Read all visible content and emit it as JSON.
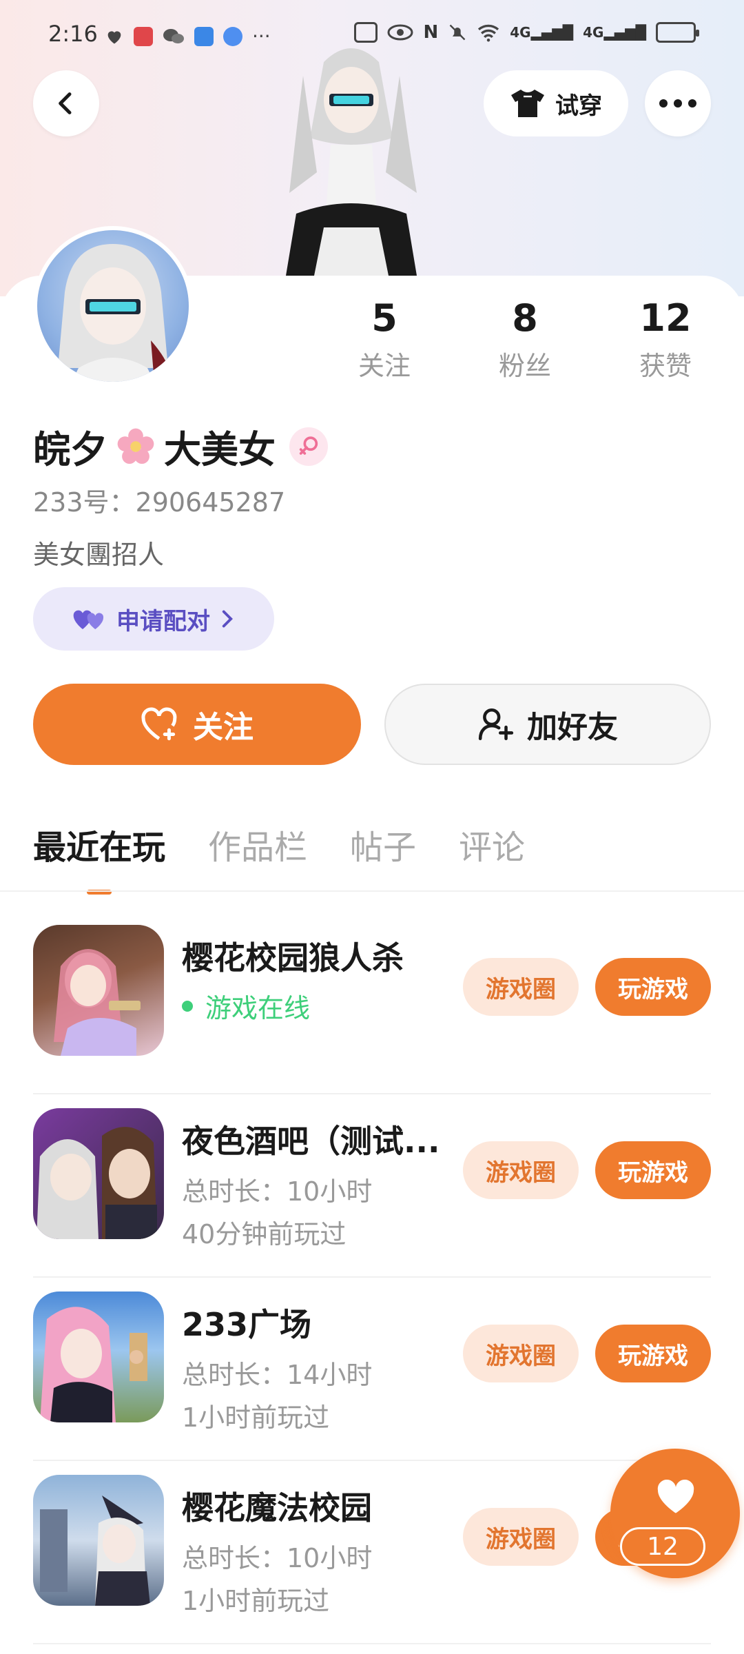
{
  "status_bar": {
    "time": "2:16",
    "more": "···",
    "net1": "4G",
    "net2": "4G"
  },
  "header": {
    "tryon_label": "试穿"
  },
  "profile": {
    "followers_label_follow": "关注",
    "follow_count": "5",
    "fans_label": "粉丝",
    "fans_count": "8",
    "likes_label": "获赞",
    "likes_count": "12",
    "name_part1": "皖夕",
    "name_part2": "大美女",
    "uid": "233号：290645287",
    "bio": "美女團招人",
    "pair_label": "申请配对"
  },
  "actions": {
    "follow_label": "关注",
    "add_friend_label": "加好友"
  },
  "tabs": [
    {
      "label": "最近在玩",
      "active": true
    },
    {
      "label": "作品栏",
      "active": false
    },
    {
      "label": "帖子",
      "active": false
    },
    {
      "label": "评论",
      "active": false
    }
  ],
  "games": [
    {
      "title": "樱花校园狼人杀",
      "line1": "游戏在线",
      "line2": "",
      "online": true,
      "circle_label": "游戏圈",
      "play_label": "玩游戏"
    },
    {
      "title": "夜色酒吧（测试...",
      "line1": "总时长：10小时",
      "line2": "40分钟前玩过",
      "online": false,
      "circle_label": "游戏圈",
      "play_label": "玩游戏"
    },
    {
      "title": "233广场",
      "line1": "总时长：14小时",
      "line2": "1小时前玩过",
      "online": false,
      "circle_label": "游戏圈",
      "play_label": "玩游戏"
    },
    {
      "title": "樱花魔法校园",
      "line1": "总时长：10小时",
      "line2": "1小时前玩过",
      "online": false,
      "circle_label": "游戏圈",
      "play_label": "玩游戏"
    }
  ],
  "like_fab": {
    "count": "12"
  },
  "colors": {
    "accent": "#f07c2e",
    "accent_soft": "#fde7da",
    "online": "#3ecf7a",
    "pair_bg": "#ebe9fa",
    "pair_text": "#5a4ec2"
  }
}
